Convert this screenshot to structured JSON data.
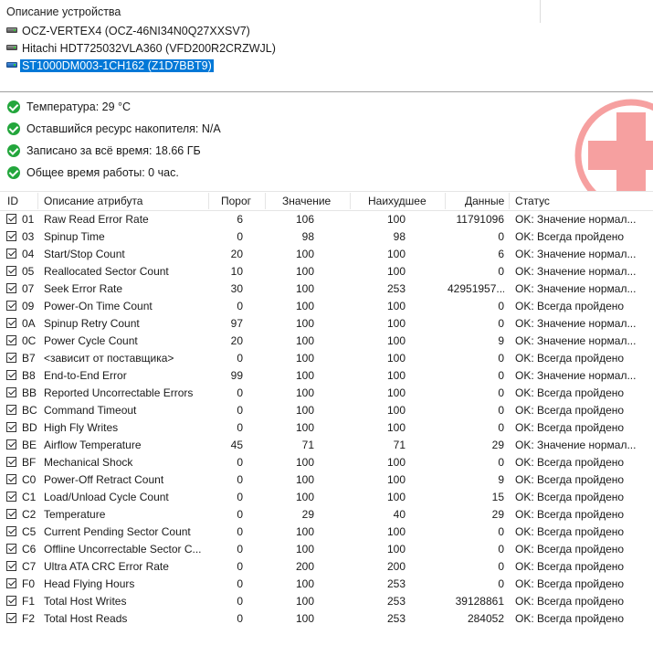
{
  "device_panel": {
    "title": "Описание устройства",
    "devices": [
      {
        "label": "OCZ-VERTEX4 (OCZ-46NI34N0Q27XXSV7)",
        "selected": false
      },
      {
        "label": "Hitachi HDT725032VLA360 (VFD200R2CRZWJL)",
        "selected": false
      },
      {
        "label": "ST1000DM003-1CH162 (Z1D7BBT9)",
        "selected": true
      }
    ]
  },
  "status": {
    "lines": [
      "Температура: 29 °C",
      "Оставшийся ресурс накопителя: N/A",
      "Записано за всё время: 18.66 ГБ",
      "Общее время работы: 0 час."
    ],
    "badge_color": "#f04a4a",
    "ok_color": "#23a63c"
  },
  "table": {
    "headers": [
      "ID",
      "Описание атрибута",
      "Порог",
      "Значение",
      "Наихудшее",
      "Данные",
      "Статус"
    ],
    "rows": [
      {
        "id": "01",
        "name": "Raw Read Error Rate",
        "threshold": "6",
        "value": "106",
        "worst": "100",
        "data": "11791096",
        "status": "OK: Значение нормал..."
      },
      {
        "id": "03",
        "name": "Spinup Time",
        "threshold": "0",
        "value": "98",
        "worst": "98",
        "data": "0",
        "status": "OK: Всегда пройдено"
      },
      {
        "id": "04",
        "name": "Start/Stop Count",
        "threshold": "20",
        "value": "100",
        "worst": "100",
        "data": "6",
        "status": "OK: Значение нормал..."
      },
      {
        "id": "05",
        "name": "Reallocated Sector Count",
        "threshold": "10",
        "value": "100",
        "worst": "100",
        "data": "0",
        "status": "OK: Значение нормал..."
      },
      {
        "id": "07",
        "name": "Seek Error Rate",
        "threshold": "30",
        "value": "100",
        "worst": "253",
        "data": "42951957...",
        "status": "OK: Значение нормал..."
      },
      {
        "id": "09",
        "name": "Power-On Time Count",
        "threshold": "0",
        "value": "100",
        "worst": "100",
        "data": "0",
        "status": "OK: Всегда пройдено"
      },
      {
        "id": "0A",
        "name": "Spinup Retry Count",
        "threshold": "97",
        "value": "100",
        "worst": "100",
        "data": "0",
        "status": "OK: Значение нормал..."
      },
      {
        "id": "0C",
        "name": "Power Cycle Count",
        "threshold": "20",
        "value": "100",
        "worst": "100",
        "data": "9",
        "status": "OK: Значение нормал..."
      },
      {
        "id": "B7",
        "name": "<зависит от поставщика>",
        "threshold": "0",
        "value": "100",
        "worst": "100",
        "data": "0",
        "status": "OK: Всегда пройдено"
      },
      {
        "id": "B8",
        "name": "End-to-End Error",
        "threshold": "99",
        "value": "100",
        "worst": "100",
        "data": "0",
        "status": "OK: Значение нормал..."
      },
      {
        "id": "BB",
        "name": "Reported Uncorrectable Errors",
        "threshold": "0",
        "value": "100",
        "worst": "100",
        "data": "0",
        "status": "OK: Всегда пройдено"
      },
      {
        "id": "BC",
        "name": "Command Timeout",
        "threshold": "0",
        "value": "100",
        "worst": "100",
        "data": "0",
        "status": "OK: Всегда пройдено"
      },
      {
        "id": "BD",
        "name": "High Fly Writes",
        "threshold": "0",
        "value": "100",
        "worst": "100",
        "data": "0",
        "status": "OK: Всегда пройдено"
      },
      {
        "id": "BE",
        "name": "Airflow Temperature",
        "threshold": "45",
        "value": "71",
        "worst": "71",
        "data": "29",
        "status": "OK: Значение нормал..."
      },
      {
        "id": "BF",
        "name": "Mechanical Shock",
        "threshold": "0",
        "value": "100",
        "worst": "100",
        "data": "0",
        "status": "OK: Всегда пройдено"
      },
      {
        "id": "C0",
        "name": "Power-Off Retract Count",
        "threshold": "0",
        "value": "100",
        "worst": "100",
        "data": "9",
        "status": "OK: Всегда пройдено"
      },
      {
        "id": "C1",
        "name": "Load/Unload Cycle Count",
        "threshold": "0",
        "value": "100",
        "worst": "100",
        "data": "15",
        "status": "OK: Всегда пройдено"
      },
      {
        "id": "C2",
        "name": "Temperature",
        "threshold": "0",
        "value": "29",
        "worst": "40",
        "data": "29",
        "status": "OK: Всегда пройдено"
      },
      {
        "id": "C5",
        "name": "Current Pending Sector Count",
        "threshold": "0",
        "value": "100",
        "worst": "100",
        "data": "0",
        "status": "OK: Всегда пройдено"
      },
      {
        "id": "C6",
        "name": "Offline Uncorrectable Sector C...",
        "threshold": "0",
        "value": "100",
        "worst": "100",
        "data": "0",
        "status": "OK: Всегда пройдено"
      },
      {
        "id": "C7",
        "name": "Ultra ATA CRC Error Rate",
        "threshold": "0",
        "value": "200",
        "worst": "200",
        "data": "0",
        "status": "OK: Всегда пройдено"
      },
      {
        "id": "F0",
        "name": "Head Flying Hours",
        "threshold": "0",
        "value": "100",
        "worst": "253",
        "data": "0",
        "status": "OK: Всегда пройдено"
      },
      {
        "id": "F1",
        "name": "Total Host Writes",
        "threshold": "0",
        "value": "100",
        "worst": "253",
        "data": "39128861",
        "status": "OK: Всегда пройдено"
      },
      {
        "id": "F2",
        "name": "Total Host Reads",
        "threshold": "0",
        "value": "100",
        "worst": "253",
        "data": "284052",
        "status": "OK: Всегда пройдено"
      }
    ]
  }
}
